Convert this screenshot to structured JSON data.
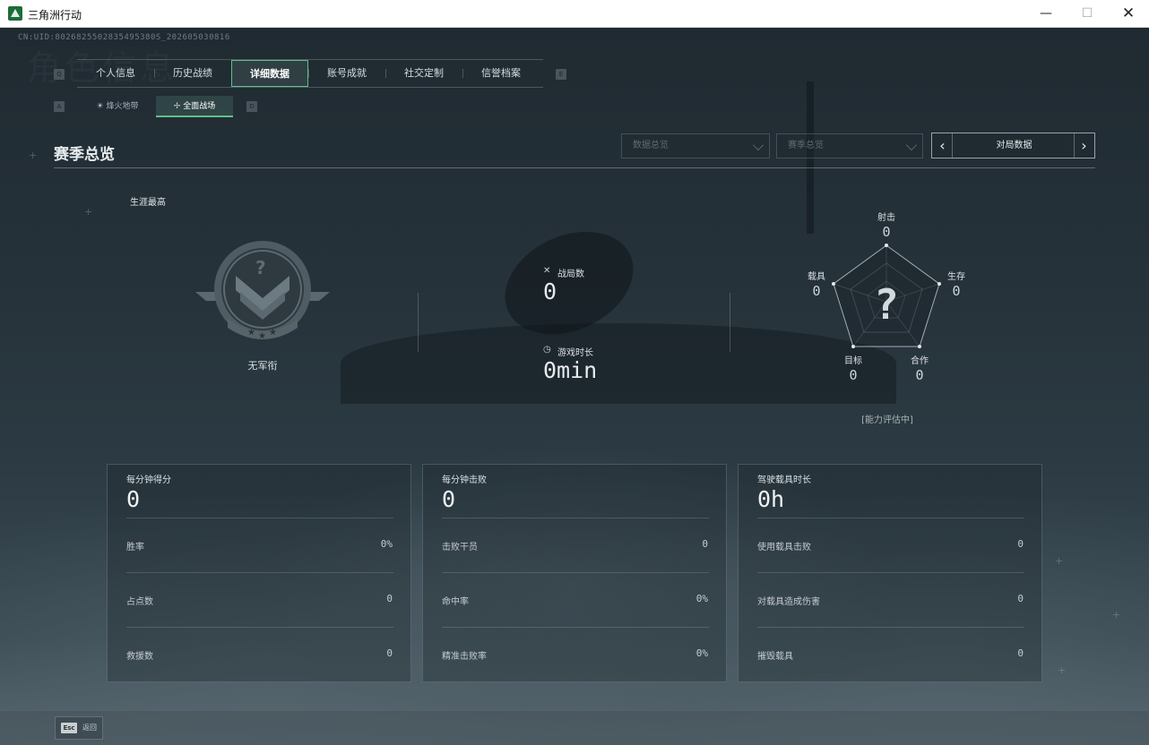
{
  "window": {
    "title": "三角洲行动",
    "minimize": "—",
    "maximize": "☐",
    "close": "✕"
  },
  "page": {
    "uid": "CN:UID:8026825502835495380S_202605030816",
    "watermark": "角色信息"
  },
  "main_tabs": {
    "left_key": "Q",
    "right_key": "E",
    "items": [
      {
        "label": "个人信息"
      },
      {
        "label": "历史战绩"
      },
      {
        "label": "详细数据",
        "active": true
      },
      {
        "label": "账号成就"
      },
      {
        "label": "社交定制"
      },
      {
        "label": "信誉档案"
      }
    ]
  },
  "sub_tabs": {
    "left_key": "A",
    "right_key": "D",
    "items": [
      {
        "label": "烽火地带",
        "icon": "☀"
      },
      {
        "label": "全面战场",
        "icon": "✢",
        "active": true
      }
    ]
  },
  "section": {
    "title": "赛季总览",
    "dropdown_1": "数据总览",
    "dropdown_2": "赛季总览",
    "stepper_label": "对局数据",
    "stepper_left": "‹",
    "stepper_right": "›"
  },
  "career": {
    "label": "生涯最高",
    "rank_name": "无军衔",
    "emblem_symbol": "?"
  },
  "center_stats": {
    "matches_label": "战局数",
    "matches_icon": "crossed-swords-icon",
    "matches_glyph": "✕",
    "matches_value": "0",
    "playtime_label": "游戏时长",
    "playtime_icon": "clock-icon",
    "playtime_glyph": "◷",
    "playtime_value": "0min"
  },
  "radar": {
    "center_symbol": "?",
    "axes": [
      {
        "label": "射击",
        "value": "0"
      },
      {
        "label": "生存",
        "value": "0"
      },
      {
        "label": "合作",
        "value": "0"
      },
      {
        "label": "目标",
        "value": "0"
      },
      {
        "label": "载具",
        "value": "0"
      }
    ],
    "note": "[能力评估中]"
  },
  "cards": [
    {
      "title": "每分钟得分",
      "big_value": "0",
      "rows": [
        {
          "label": "胜率",
          "value": "0%"
        },
        {
          "label": "占点数",
          "value": "0"
        },
        {
          "label": "救援数",
          "value": "0"
        }
      ]
    },
    {
      "title": "每分钟击败",
      "big_value": "0",
      "rows": [
        {
          "label": "击败干员",
          "value": "0"
        },
        {
          "label": "命中率",
          "value": "0%"
        },
        {
          "label": "精准击败率",
          "value": "0%"
        }
      ]
    },
    {
      "title": "驾驶载具时长",
      "big_value": "0h",
      "rows": [
        {
          "label": "使用载具击败",
          "value": "0"
        },
        {
          "label": "对载具造成伤害",
          "value": "0"
        },
        {
          "label": "摧毁载具",
          "value": "0"
        }
      ]
    }
  ],
  "bottom": {
    "esc_key": "Esc",
    "esc_label": "返回"
  },
  "colors": {
    "accent": "#5fbf8c",
    "background": "#1f2a31"
  }
}
